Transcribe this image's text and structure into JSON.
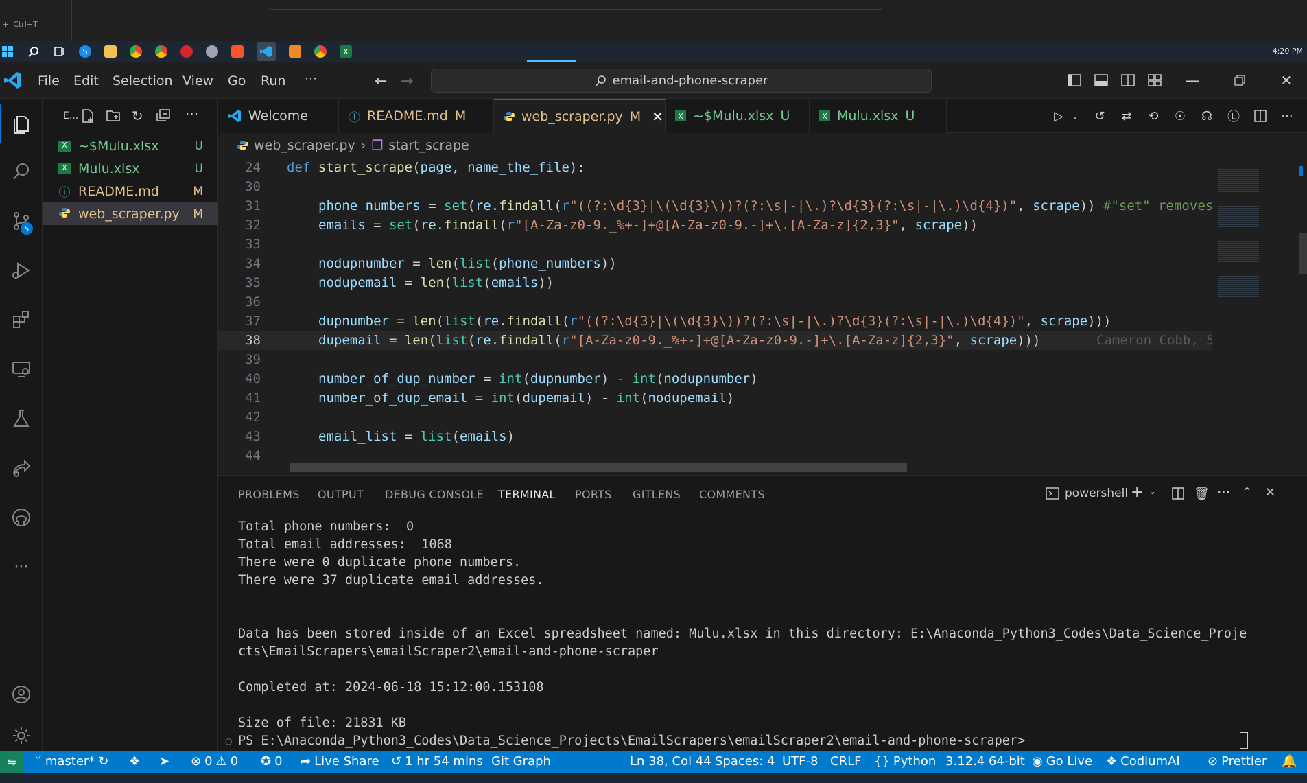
{
  "browser": {
    "new_tab_hint": "Ctrl+T"
  },
  "taskbar": {
    "time": "4:20 PM"
  },
  "titlebar": {
    "menu": [
      "File",
      "Edit",
      "Selection",
      "View",
      "Go",
      "Run",
      "···"
    ],
    "command_center": "email-and-phone-scraper"
  },
  "activity": {
    "scm_badge": "5"
  },
  "explorer": {
    "header": "E...",
    "files": [
      {
        "name": "~$Mulu.xlsx",
        "status": "U",
        "icon": "excel-icon"
      },
      {
        "name": "Mulu.xlsx",
        "status": "U",
        "icon": "excel-icon"
      },
      {
        "name": "README.md",
        "status": "M",
        "icon": "info-icon"
      },
      {
        "name": "web_scraper.py",
        "status": "M",
        "icon": "python-icon"
      }
    ]
  },
  "tabs": [
    {
      "label": "Welcome",
      "status": ""
    },
    {
      "label": "README.md",
      "status": "M"
    },
    {
      "label": "web_scraper.py",
      "status": "M"
    },
    {
      "label": "~$Mulu.xlsx",
      "status": "U"
    },
    {
      "label": "Mulu.xlsx",
      "status": "U"
    }
  ],
  "breadcrumb": {
    "file": "web_scraper.py",
    "symbol": "start_scrape"
  },
  "editor": {
    "line_numbers": [
      "24",
      "30",
      "31",
      "32",
      "33",
      "34",
      "35",
      "36",
      "37",
      "38",
      "39",
      "40",
      "41",
      "42",
      "43",
      "44"
    ],
    "blame": "Cameron Cobb, 5"
  },
  "panel": {
    "tabs": [
      "PROBLEMS",
      "OUTPUT",
      "DEBUG CONSOLE",
      "TERMINAL",
      "PORTS",
      "GITLENS",
      "COMMENTS"
    ],
    "shell": "powershell",
    "terminal_lines": [
      "Total phone numbers:  0",
      "Total email addresses:  1068",
      "There were 0 duplicate phone numbers.",
      "There were 37 duplicate email addresses.",
      "",
      "",
      "Data has been stored inside of an Excel spreadsheet named: Mulu.xlsx in this directory: E:\\Anaconda_Python3_Codes\\Data_Science_Proje",
      "cts\\EmailScrapers\\emailScraper2\\email-and-phone-scraper",
      "",
      "Completed at: 2024-06-18 15:12:00.153108",
      "",
      "Size of file: 21831 KB",
      "PS E:\\Anaconda_Python3_Codes\\Data_Science_Projects\\EmailScrapers\\emailScraper2\\email-and-phone-scraper> "
    ]
  },
  "statusbar": {
    "branch": "master*",
    "errors": "0",
    "warnings": "0",
    "ports": "0",
    "live_share": "Live Share",
    "time_tracked": "1 hr 54 mins",
    "git_graph": "Git Graph",
    "cursor": "Ln 38, Col 44",
    "spaces": "Spaces: 4",
    "encoding": "UTF-8",
    "eol": "CRLF",
    "language": "Python",
    "interpreter": "3.12.4 64-bit",
    "go_live": "Go Live",
    "codium": "CodiumAI",
    "prettier": "Prettier"
  },
  "colors": {
    "accent": "#0078d4",
    "statusbar": "#007acc",
    "modified": "#e2c08d",
    "untracked": "#73c991"
  }
}
